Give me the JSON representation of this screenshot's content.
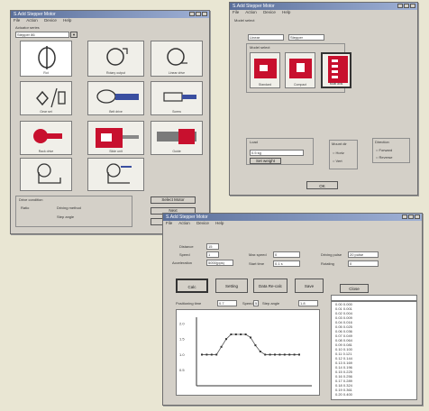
{
  "windows": {
    "w1": {
      "title": "S.Add Stepper Motor",
      "menu": [
        "File",
        "Action",
        "Device",
        "Help"
      ],
      "group_label": "Actuator series"
    },
    "w2": {
      "title": "S.Add Stepper Motor",
      "menu": [
        "File",
        "Action",
        "Device",
        "Help"
      ],
      "group_label": "Model select"
    },
    "w3": {
      "title": "S.Add Stepper Motor",
      "menu": [
        "File",
        "Action",
        "Device",
        "Help"
      ]
    }
  },
  "w1": {
    "dropdown_value": "Stepper 86",
    "tiles": [
      {
        "id": "rotary",
        "caption": "Rot"
      },
      {
        "id": "rotary-out",
        "caption": "Rotary output"
      },
      {
        "id": "linear-drive",
        "caption": "Linear drive"
      },
      {
        "id": "gear",
        "caption": "Gear set"
      },
      {
        "id": "belt",
        "caption": "Belt drive"
      },
      {
        "id": "screw",
        "caption": "Screw"
      },
      {
        "id": "rack",
        "caption": "Rack drive"
      },
      {
        "id": "slide",
        "caption": "Slide unit"
      },
      {
        "id": "guide",
        "caption": "Guide"
      },
      {
        "id": "index",
        "caption": ""
      },
      {
        "id": "lift",
        "caption": ""
      }
    ],
    "info_group": "Drive condition",
    "info_labels": [
      "Ratio",
      "Driving method",
      "Step angle"
    ],
    "buttons": [
      "Select Motor",
      "Next",
      "Back"
    ]
  },
  "w2": {
    "field_left": "Linear",
    "field_right": "Stepper",
    "sub_group": "Model select",
    "tiles": [
      {
        "id": "a",
        "caption": "Standard"
      },
      {
        "id": "b",
        "caption": "Compact"
      },
      {
        "id": "c",
        "caption": "Multi axis"
      }
    ],
    "load_group": "Load",
    "load_field": "0.5 kg",
    "load_button": "Set weight",
    "middle_group": "Mount dir",
    "middle_options": [
      "Horiz",
      "Vert"
    ],
    "right_group": "Direction",
    "right_options": [
      "Forward",
      "Reverse"
    ],
    "ok_button": "OK"
  },
  "w3": {
    "fields": [
      {
        "label": "Distance",
        "value": "15"
      },
      {
        "label": "Speed",
        "value": "1"
      },
      {
        "label": "Acceleration",
        "value": "5000(pps)"
      },
      {
        "label": "Max speed",
        "value": "0"
      },
      {
        "label": "Start time",
        "value": "0.1 s"
      },
      {
        "label": "Driving pulse",
        "value": "20 pulse"
      },
      {
        "label": "Rotating",
        "value": "0"
      }
    ],
    "buttons": [
      "Calc",
      "Setting",
      "Data Re-calc",
      "Save",
      "Close"
    ],
    "stat_labels": [
      "Positioning time",
      "Speed",
      "Step angle"
    ],
    "stat_values": [
      "0.7",
      "5",
      "1.8"
    ],
    "plot_yticks": [
      "2.0",
      "1.5",
      "1.0",
      "0.5"
    ],
    "list_rows": [
      "0.00  0.000",
      "0.01  0.001",
      "0.02  0.004",
      "0.03  0.009",
      "0.04  0.016",
      "0.05  0.025",
      "0.06  0.036",
      "0.07  0.049",
      "0.08  0.064",
      "0.09  0.081",
      "0.10  0.100",
      "0.11  0.121",
      "0.12  0.144",
      "0.13  0.169",
      "0.14  0.196",
      "0.15  0.225",
      "0.16  0.256",
      "0.17  0.289",
      "0.18  0.324",
      "0.19  0.361",
      "0.20  0.400"
    ]
  },
  "chart_data": {
    "type": "line",
    "x": [
      0,
      1,
      2,
      3,
      4,
      5,
      6,
      7,
      8,
      9,
      10,
      11,
      12,
      13,
      14,
      15,
      16,
      17,
      18,
      19,
      20
    ],
    "values": [
      1.0,
      1.0,
      1.0,
      1.0,
      1.25,
      1.5,
      1.65,
      1.65,
      1.65,
      1.65,
      1.55,
      1.3,
      1.1,
      1.0,
      1.0,
      1.0,
      1.0,
      1.0,
      1.0,
      1.0,
      1.0
    ],
    "ylim": [
      0,
      2.2
    ],
    "title": "",
    "xlabel": "",
    "ylabel": ""
  }
}
